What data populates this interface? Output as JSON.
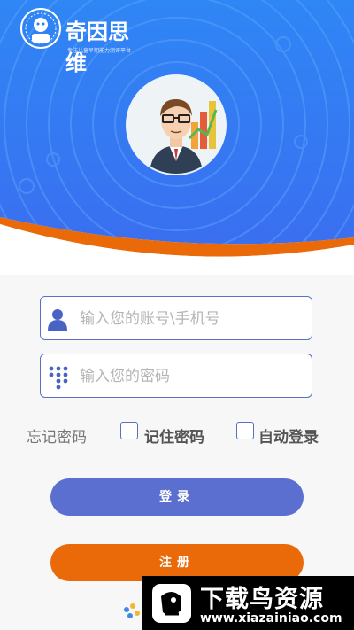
{
  "app": {
    "logo_text": "奇因思维",
    "logo_tagline": "专注儿童早期能力测评平台"
  },
  "login_form": {
    "account_placeholder": "输入您的账号\\手机号",
    "password_placeholder": "输入您的密码",
    "forgot_password": "忘记密码",
    "remember_password": "记住密码",
    "auto_login": "自动登录",
    "remember_checked": false,
    "auto_login_checked": false,
    "login_button": "登录",
    "register_button": "注册"
  },
  "watermark": {
    "title": "下载鸟资源",
    "url": "www.xiazainiao.com"
  },
  "colors": {
    "header_blue": "#2f7cf0",
    "accent_orange": "#ea6a0a",
    "button_blue": "#5a6fcf"
  }
}
